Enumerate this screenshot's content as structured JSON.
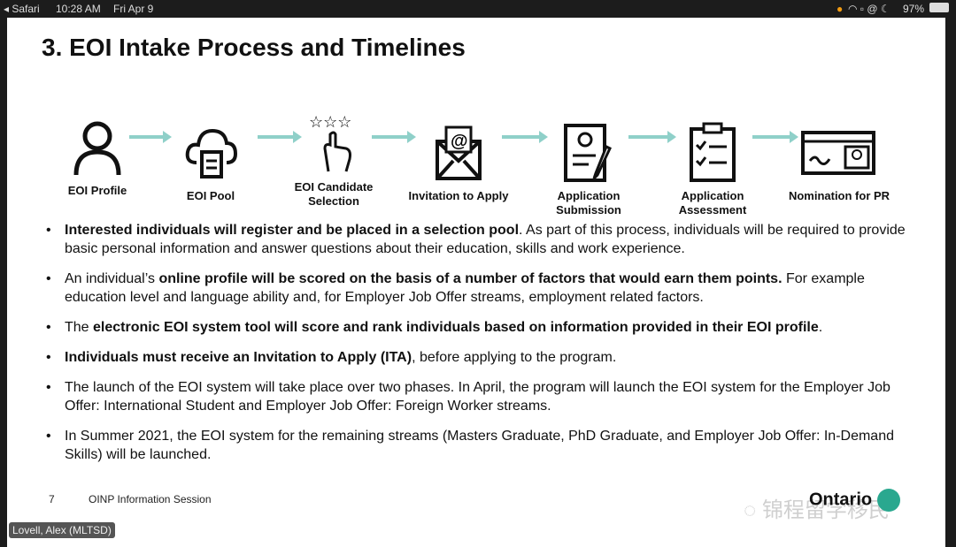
{
  "status_bar": {
    "app": "Safari",
    "time": "10:28 AM",
    "date": "Fri Apr 9",
    "battery": "97%"
  },
  "slide": {
    "title": "3. EOI Intake Process and Timelines",
    "steps": [
      {
        "label": "EOI Profile",
        "icon": "person-icon"
      },
      {
        "label": "EOI Pool",
        "icon": "cloud-document-icon"
      },
      {
        "label": "EOI Candidate Selection",
        "icon": "hand-stars-icon"
      },
      {
        "label": "Invitation to Apply",
        "icon": "envelope-at-icon"
      },
      {
        "label": "Application Submission",
        "icon": "form-pen-icon"
      },
      {
        "label": "Application Assessment",
        "icon": "clipboard-checklist-icon"
      },
      {
        "label": "Nomination for PR",
        "icon": "id-card-icon"
      }
    ],
    "bullets": [
      {
        "bold": "Interested individuals will register and be placed in a selection pool",
        "rest": ". As part of this process, individuals will be required to provide basic personal information and answer questions about their education, skills and work experience."
      },
      {
        "pre": "An individual’s ",
        "bold": "online profile will be scored on the basis of a number of factors that would earn them points.",
        "rest": " For example education level and language ability and, for Employer Job Offer streams, employment related factors."
      },
      {
        "pre": "The ",
        "bold": "electronic EOI system tool will score and rank individuals based on information provided in their EOI profile",
        "rest": "."
      },
      {
        "bold": "Individuals must receive an Invitation to Apply (ITA)",
        "rest": ", before applying to the program."
      },
      {
        "pre": "The launch of the EOI system will take place over two phases.  In April, the program will launch the EOI system for the Employer Job Offer: International Student and Employer Job Offer: Foreign Worker streams."
      },
      {
        "pre": "In Summer 2021, the EOI system for the remaining streams (Masters Graduate, PhD Graduate, and Employer Job Offer: In-Demand Skills) will be launched."
      }
    ],
    "page_number": "7",
    "footer": "OINP Information Session",
    "logo": "Ontario",
    "watermark": "锦程留学移民"
  },
  "participant_name": "Lovell, Alex (MLTSD)"
}
